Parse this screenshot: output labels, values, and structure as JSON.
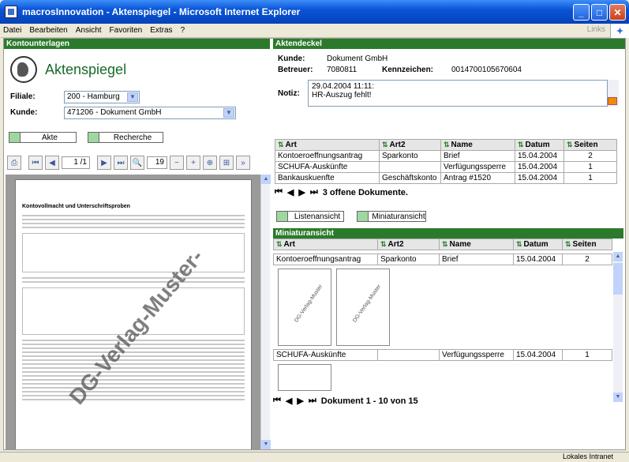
{
  "window": {
    "title": "macrosInnovation - Aktenspiegel - Microsoft Internet Explorer"
  },
  "menu": {
    "items": [
      "Datei",
      "Bearbeiten",
      "Ansicht",
      "Favoriten",
      "Extras",
      "?"
    ],
    "links": "Links"
  },
  "left": {
    "header": "Kontounterlagen",
    "logo_text": "Aktenspiegel",
    "filiale_label": "Filiale:",
    "filiale_value": "200 - Hamburg",
    "kunde_label": "Kunde:",
    "kunde_value": "471206 - Dokument GmbH",
    "btn_akte": "Akte",
    "btn_recherche": "Recherche",
    "page_field": "1 /1",
    "zoom_field": "19",
    "watermark": "DG-Verlag-Muster-",
    "doc_title": "Kontovollmacht und Unterschriftsproben"
  },
  "right": {
    "header": "Aktendeckel",
    "kunde_label": "Kunde:",
    "kunde_value": "Dokument GmbH",
    "betreuer_label": "Betreuer:",
    "betreuer_value": "7080811",
    "kennzeichen_label": "Kennzeichen:",
    "kennzeichen_value": "0014700105670604",
    "notiz_label": "Notiz:",
    "notiz_line1": "29.04.2004 11:11:",
    "notiz_line2": "HR-Auszug fehlt!",
    "columns": [
      "Art",
      "Art2",
      "Name",
      "Datum",
      "Seiten"
    ],
    "rows": [
      [
        "Kontoeroeffnungsantrag",
        "Sparkonto",
        "Brief",
        "15.04.2004",
        "2"
      ],
      [
        "SCHUFA-Auskünfte",
        "",
        "Verfügungssperre",
        "15.04.2004",
        "1"
      ],
      [
        "Bankauskuenfte",
        "Geschäftskonto",
        "Antrag #1520",
        "15.04.2004",
        "1"
      ]
    ],
    "offene": "3 offene Dokumente.",
    "btn_liste": "Listenansicht",
    "btn_mini": "Miniaturansicht",
    "mini_header": "Miniaturansicht",
    "mini_rows": [
      [
        "Kontoeroeffnungsantrag",
        "Sparkonto",
        "Brief",
        "15.04.2004",
        "2"
      ],
      [
        "SCHUFA-Auskünfte",
        "",
        "Verfügungssperre",
        "15.04.2004",
        "1"
      ]
    ],
    "mini_thumb_text": "DG-Verlag-Muster",
    "mini_nav": "Dokument 1 - 10 von 15"
  },
  "status": {
    "zone": "Lokales Intranet"
  }
}
